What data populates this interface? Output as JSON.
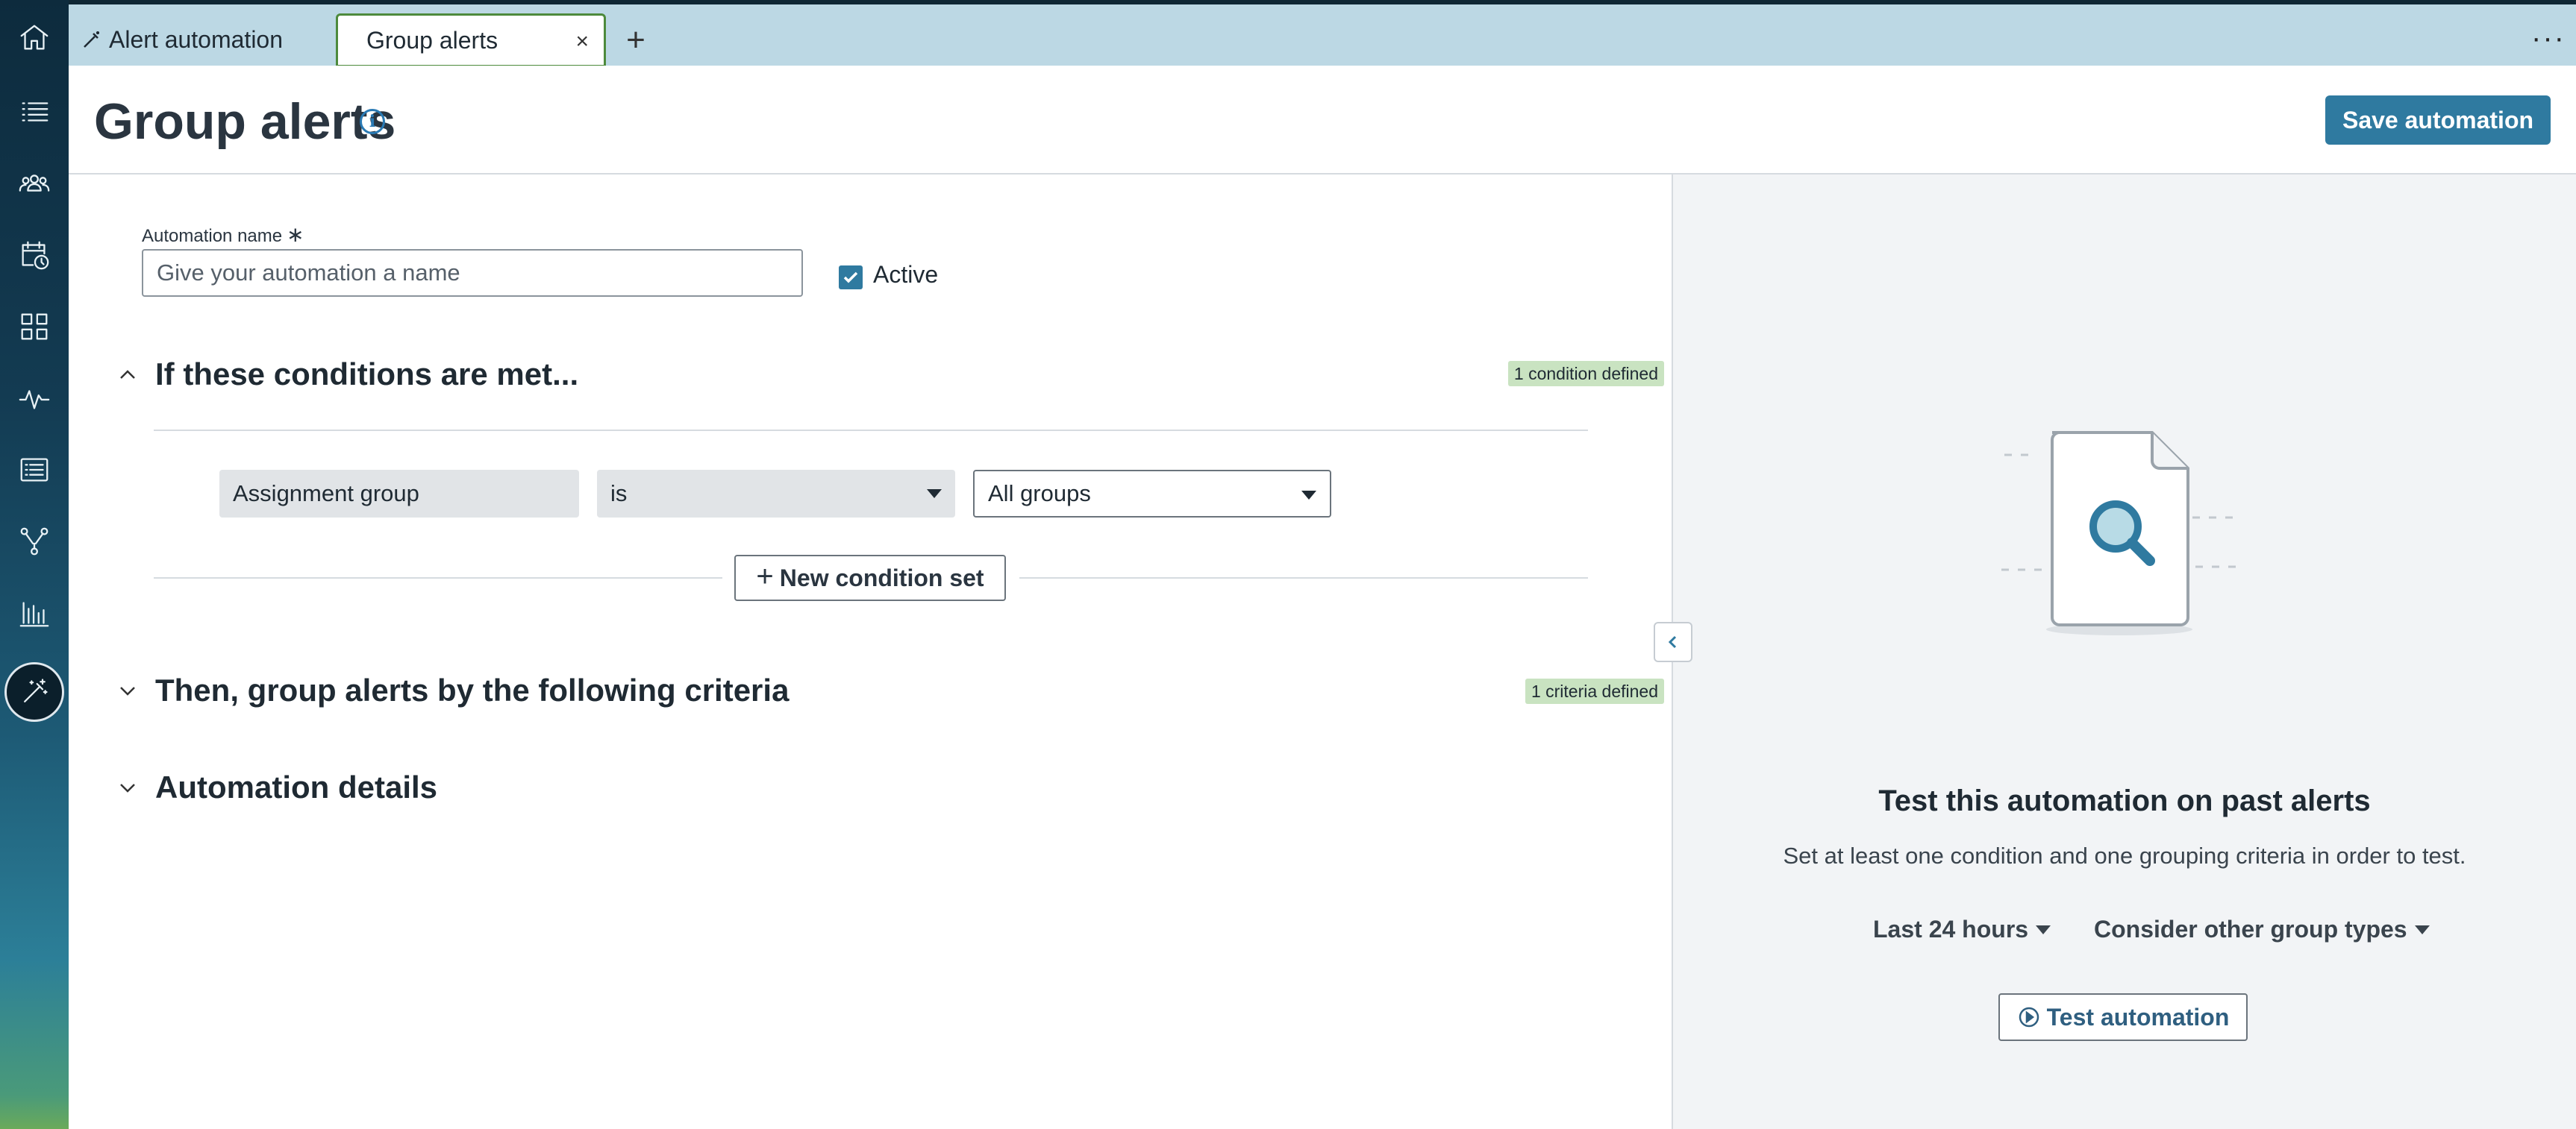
{
  "tabs": {
    "first_label": "Alert automation",
    "active_label": "Group alerts",
    "close_glyph": "×",
    "add_glyph": "+",
    "more_glyph": "···"
  },
  "header": {
    "title": "Group alerts",
    "info_glyph": "i",
    "save_label": "Save automation"
  },
  "form": {
    "name_label": "Automation name",
    "required_glyph": "∗",
    "name_placeholder": "Give your automation a name",
    "name_value": "",
    "active_label": "Active",
    "active_checked": true
  },
  "conditions": {
    "title": "If these conditions are met...",
    "badge": "1 condition defined",
    "field": "Assignment group",
    "operator": "is",
    "value": "All groups",
    "new_set_label": "New condition set"
  },
  "grouping": {
    "title": "Then, group alerts by the following criteria",
    "badge": "1 criteria defined"
  },
  "details": {
    "title": "Automation details"
  },
  "side": {
    "title": "Test this automation on past alerts",
    "description": "Set at least one condition and one grouping criteria in order to test.",
    "time_range": "Last 24 hours",
    "group_types": "Consider other group types",
    "test_label": "Test automation"
  },
  "icons": {
    "rail": [
      "home-icon",
      "list-icon",
      "people-icon",
      "calendar-clock-icon",
      "grid-icon",
      "pulse-icon",
      "report-icon",
      "branch-icon",
      "bar-chart-icon",
      "magic-wand-icon"
    ]
  },
  "colors": {
    "accent": "#2f7aa0",
    "tab_bar": "#bcd8e4",
    "badge_bg": "#c9e3c1",
    "active_tab_border": "#4d8a3c"
  }
}
